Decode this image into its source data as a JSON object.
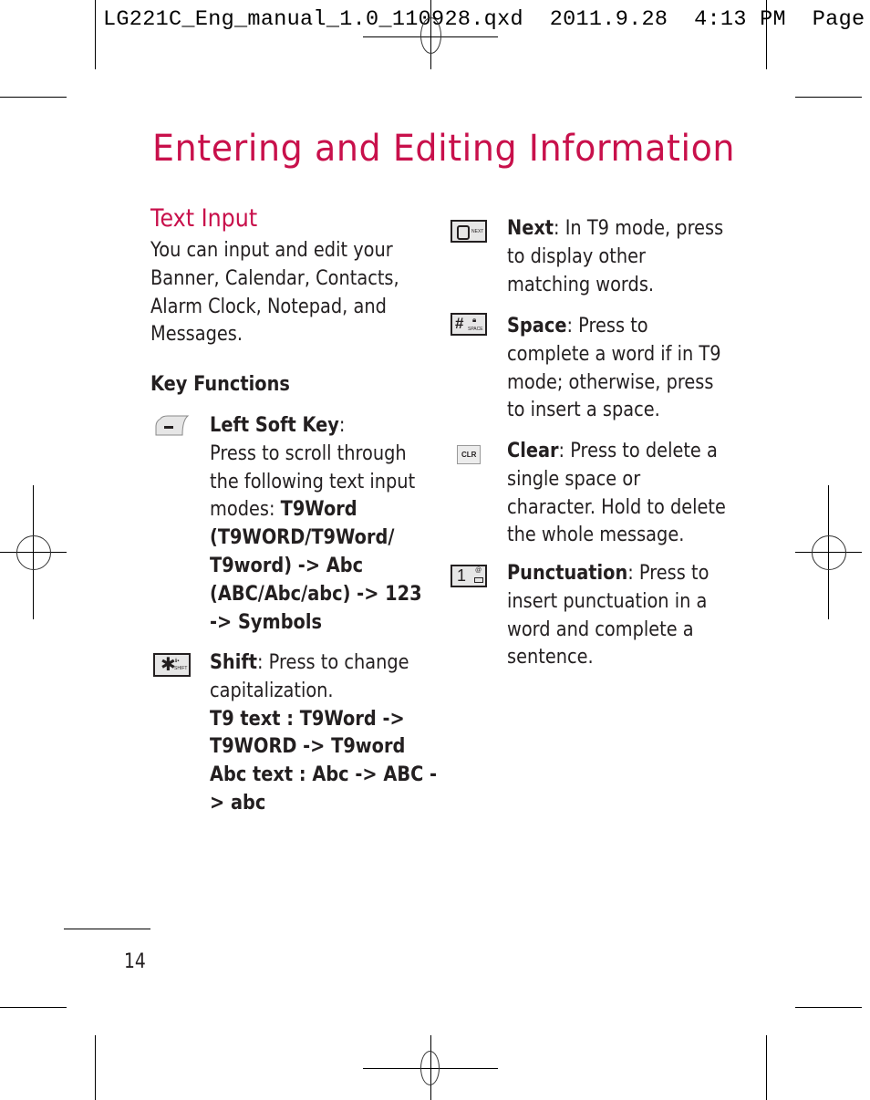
{
  "slug_line": {
    "filename": "LG221C_Eng_manual_1.0_110928.qxd",
    "date": "2011.9.28",
    "time": "4:13",
    "ampm": "PM",
    "page_label": "Page"
  },
  "page": {
    "title": "Entering and Editing Information",
    "page_number": "14",
    "accent_color": "#c8104b"
  },
  "section": {
    "heading": "Text Input",
    "intro_lines": [
      "You can input and edit your",
      "Banner, Calendar, Contacts,",
      "Alarm Clock, Notepad, and",
      "Messages."
    ],
    "key_functions_heading": "Key Functions"
  },
  "keys": [
    {
      "icon": "left-soft-key-icon",
      "name": "Left Soft Key",
      "lines": [
        [
          {
            "t": "Left Soft Key",
            "b": true
          },
          {
            "t": ":",
            "b": false
          }
        ],
        [
          {
            "t": "Press to scroll through",
            "b": false
          }
        ],
        [
          {
            "t": "the following text input",
            "b": false
          }
        ],
        [
          {
            "t": "modes: ",
            "b": false
          },
          {
            "t": "T9Word",
            "b": true
          }
        ],
        [
          {
            "t": "(T9WORD/T9Word/",
            "b": true
          }
        ],
        [
          {
            "t": "T9word) -> Abc",
            "b": true
          }
        ],
        [
          {
            "t": "(ABC/Abc/abc) -> 123",
            "b": true
          }
        ],
        [
          {
            "t": "-> Symbols",
            "b": true
          }
        ]
      ]
    },
    {
      "icon": "star-shift-key-icon",
      "name": "Shift",
      "key_label": "SHIFT",
      "lines": [
        [
          {
            "t": "Shift",
            "b": true
          },
          {
            "t": ": Press to change",
            "b": false
          }
        ],
        [
          {
            "t": "capitalization.",
            "b": false
          }
        ],
        [
          {
            "t": "T9 text : T9Word ->",
            "b": true
          }
        ],
        [
          {
            "t": "T9WORD -> T9word",
            "b": true
          }
        ],
        [
          {
            "t": "Abc text : Abc -> ABC -",
            "b": true
          }
        ],
        [
          {
            "t": "> abc",
            "b": true
          }
        ]
      ]
    },
    {
      "icon": "zero-next-key-icon",
      "name": "Next",
      "key_label": "NEXT",
      "lines": [
        [
          {
            "t": "Next",
            "b": true
          },
          {
            "t": ": In T9 mode, press",
            "b": false
          }
        ],
        [
          {
            "t": "to display other",
            "b": false
          }
        ],
        [
          {
            "t": "matching words.",
            "b": false
          }
        ]
      ]
    },
    {
      "icon": "pound-space-key-icon",
      "name": "Space",
      "key_label": "SPACE",
      "lines": [
        [
          {
            "t": "Space",
            "b": true
          },
          {
            "t": ": Press to",
            "b": false
          }
        ],
        [
          {
            "t": "complete a word if in T9",
            "b": false
          }
        ],
        [
          {
            "t": "mode; otherwise, press",
            "b": false
          }
        ],
        [
          {
            "t": "to insert a space.",
            "b": false
          }
        ]
      ]
    },
    {
      "icon": "clear-key-icon",
      "name": "Clear",
      "key_label": "CLR",
      "lines": [
        [
          {
            "t": "Clear",
            "b": true
          },
          {
            "t": ": Press to delete a",
            "b": false
          }
        ],
        [
          {
            "t": "single space or",
            "b": false
          }
        ],
        [
          {
            "t": "character. Hold to delete",
            "b": false
          }
        ],
        [
          {
            "t": "the whole message.",
            "b": false
          }
        ]
      ]
    },
    {
      "icon": "one-punctuation-key-icon",
      "name": "Punctuation",
      "key_label": "1",
      "lines": [
        [
          {
            "t": "Punctuation",
            "b": true
          },
          {
            "t": ": Press to",
            "b": false
          }
        ],
        [
          {
            "t": "insert punctuation in a",
            "b": false
          }
        ],
        [
          {
            "t": "word and complete a",
            "b": false
          }
        ],
        [
          {
            "t": "sentence.",
            "b": false
          }
        ]
      ]
    }
  ]
}
